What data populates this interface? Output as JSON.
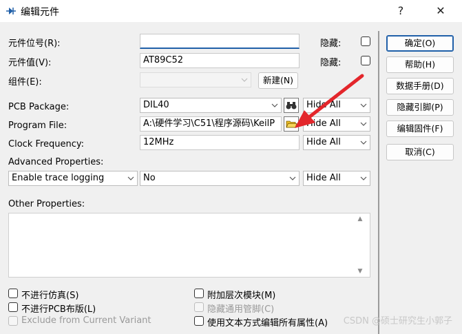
{
  "window": {
    "title": "编辑元件",
    "help_glyph": "?",
    "close_glyph": "✕",
    "icon": "component-icon"
  },
  "form": {
    "designator_label": "元件位号(R):",
    "designator_value": "",
    "hidden_label_1": "隐藏:",
    "value_label": "元件值(V):",
    "value_value": "AT89C52",
    "hidden_label_2": "隐藏:",
    "group_label": "组件(E):",
    "group_value": "",
    "new_button": "新建(N)",
    "pcb_package_label": "PCB Package:",
    "pcb_package_value": "DIL40",
    "pcb_package_vis": "Hide All",
    "program_file_label": "Program File:",
    "program_file_value": "A:\\硬件学习\\C51\\程序源码\\KeilP",
    "program_file_vis": "Hide All",
    "clock_label": "Clock Frequency:",
    "clock_value": "12MHz",
    "clock_vis": "Hide All",
    "advanced_label": "Advanced Properties:",
    "advanced_prop": "Enable trace logging",
    "advanced_value": "No",
    "advanced_vis": "Hide All",
    "other_label": "Other Properties:"
  },
  "checkboxes": {
    "no_sim": "不进行仿真(S)",
    "no_pcb": "不进行PCB布版(L)",
    "exclude_variant": "Exclude from Current Variant",
    "attach_hier": "附加层次模块(M)",
    "hide_common_pins": "隐藏通用管脚(C)",
    "edit_text": "使用文本方式编辑所有属性(A)"
  },
  "buttons": {
    "ok": "确定(O)",
    "help": "帮助(H)",
    "datasheet": "数据手册(D)",
    "hidden_pins": "隐藏引脚(P)",
    "edit_firmware": "编辑固件(F)",
    "cancel": "取消(C)"
  },
  "icons": {
    "binoculars": "binoculars-icon",
    "folder": "folder-open-icon",
    "arrow": "red-arrow-annotation"
  },
  "watermark": "CSDN @硕士研究生小郭子",
  "colors": {
    "accent": "#1f5fa8",
    "annotation_arrow": "#e3262b"
  }
}
